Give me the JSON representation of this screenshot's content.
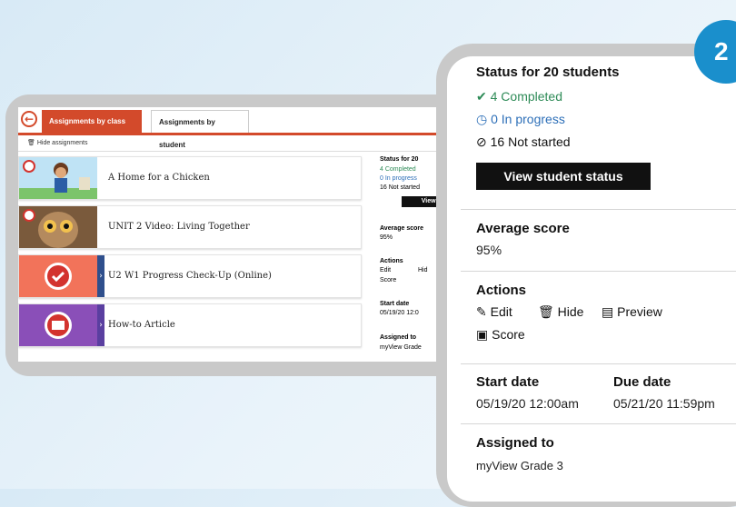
{
  "back_screen": {
    "tabs": [
      {
        "label": "Assignments by class"
      },
      {
        "label": "Assignments by student"
      }
    ],
    "hide_assignments": "Hide assignments",
    "assignments": [
      {
        "title": "A Home for a Chicken"
      },
      {
        "title": "UNIT 2 Video: Living Together"
      },
      {
        "title": "U2 W1 Progress Check-Up (Online)"
      },
      {
        "title": "How-to Article"
      }
    ],
    "mini": {
      "status": "Status for 20",
      "completed": "4 Completed",
      "in_progress": "0 In progress",
      "not_started": "16 Not started",
      "view_btn": "View stude",
      "avg_label": "Average score",
      "avg_value": "95%",
      "actions": "Actions",
      "edit": "Edit",
      "hide": "Hid",
      "score": "Score",
      "start_label": "Start date",
      "start_value": "05/19/20 12:0",
      "assigned_label": "Assigned to",
      "assigned_value": "myView Grade"
    }
  },
  "front_panel": {
    "status_title": "Status for 20 students",
    "completed": "4 Completed",
    "in_progress": "0 In progress",
    "not_started": "16 Not started",
    "view_button": "View student status",
    "avg_label": "Average score",
    "avg_value": "95%",
    "actions_label": "Actions",
    "actions": {
      "edit": "Edit",
      "hide": "Hide",
      "preview": "Preview",
      "score": "Score"
    },
    "start_label": "Start date",
    "start_value": "05/19/20 12:00am",
    "due_label": "Due date",
    "due_value": "05/21/20 11:59pm",
    "assigned_label": "Assigned to",
    "assigned_value": "myView Grade 3"
  },
  "step_badge": "2",
  "colors": {
    "accent": "#d34a2b",
    "completed": "#2e8b57",
    "in_progress": "#2d6fb8",
    "badge": "#1a8fcc"
  }
}
